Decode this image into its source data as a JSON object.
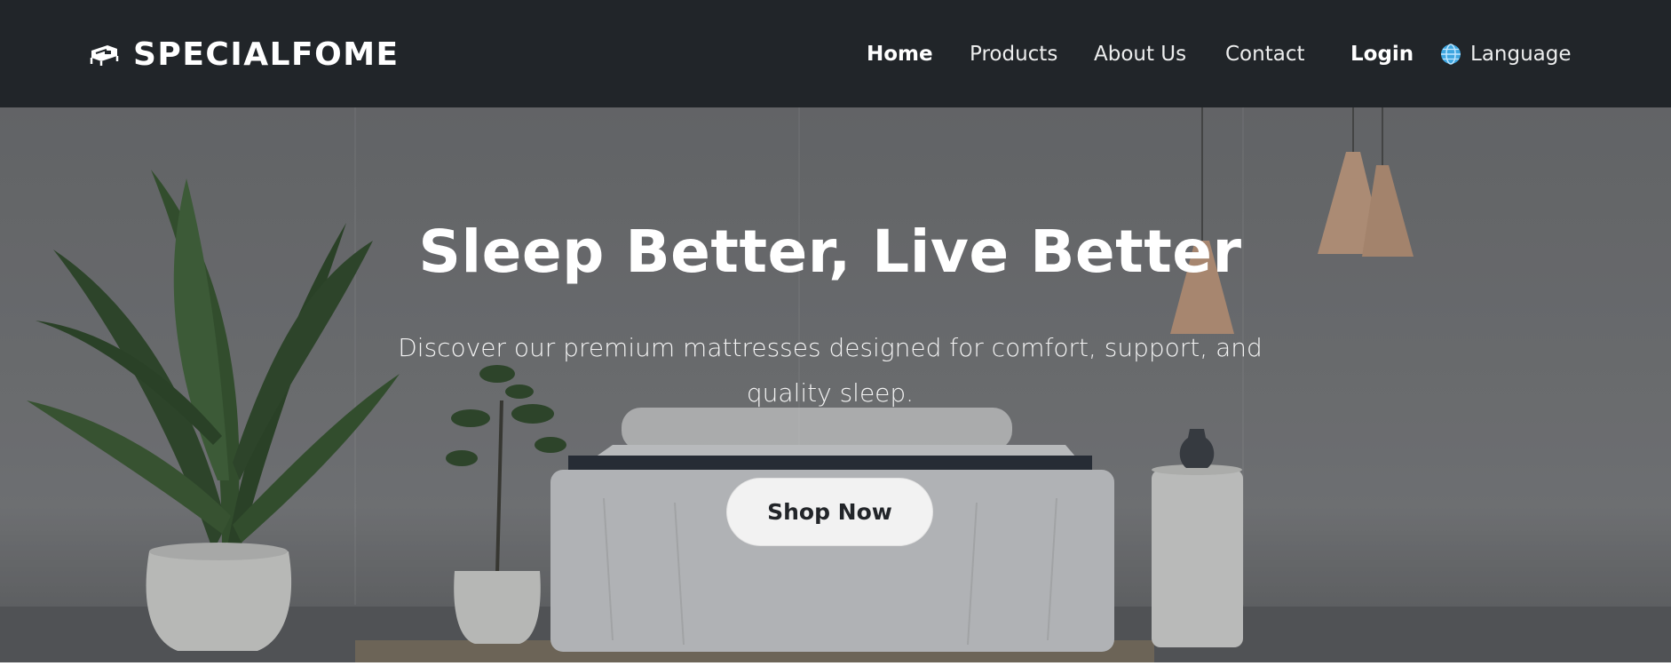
{
  "brand": {
    "name": "SPECIALFOME",
    "icon": "bed-icon"
  },
  "nav": {
    "home": "Home",
    "products": "Products",
    "about": "About Us",
    "contact": "Contact",
    "login": "Login",
    "language": "Language",
    "language_icon": "globe-icon"
  },
  "hero": {
    "title": "Sleep Better, Live Better",
    "subtitle": "Discover our premium mattresses designed for comfort, support, and quality sleep.",
    "cta": "Shop Now"
  },
  "colors": {
    "navbar_bg": "#212529",
    "button_bg": "#f2f2f2",
    "button_text": "#222529"
  }
}
